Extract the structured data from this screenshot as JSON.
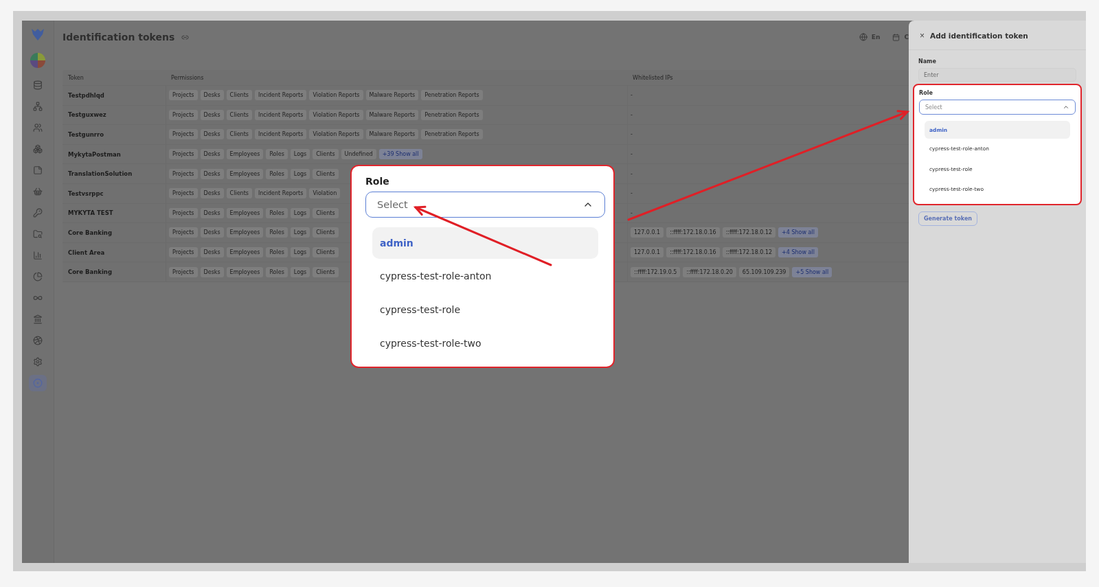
{
  "header": {
    "title": "Identification tokens",
    "language": "En",
    "cut_label": "C"
  },
  "sidebar": {
    "items": [
      {
        "selected": false
      },
      {
        "selected": false
      },
      {
        "selected": false
      },
      {
        "selected": false
      },
      {
        "selected": false
      },
      {
        "selected": false
      },
      {
        "selected": false
      },
      {
        "selected": false
      },
      {
        "selected": false
      },
      {
        "selected": false
      },
      {
        "selected": false
      },
      {
        "selected": false
      },
      {
        "selected": false
      },
      {
        "selected": false
      },
      {
        "selected": true
      }
    ]
  },
  "table": {
    "columns": [
      "Token",
      "Permissions",
      "Whitelisted IPs"
    ],
    "rows": [
      {
        "token": "Testpdhlqd",
        "permissions": [
          "Projects",
          "Desks",
          "Clients",
          "Incident Reports",
          "Violation Reports",
          "Malware Reports",
          "Penetration Reports"
        ],
        "ips": [
          "-"
        ]
      },
      {
        "token": "Testguxwez",
        "permissions": [
          "Projects",
          "Desks",
          "Clients",
          "Incident Reports",
          "Violation Reports",
          "Malware Reports",
          "Penetration Reports"
        ],
        "ips": [
          "-"
        ]
      },
      {
        "token": "Testgunrro",
        "permissions": [
          "Projects",
          "Desks",
          "Clients",
          "Incident Reports",
          "Violation Reports",
          "Malware Reports",
          "Penetration Reports"
        ],
        "ips": [
          "-"
        ]
      },
      {
        "token": "MykytaPostman",
        "permissions": [
          "Projects",
          "Desks",
          "Employees",
          "Roles",
          "Logs",
          "Clients",
          "Undefined"
        ],
        "permissions_more": "+39 Show all",
        "ips": [
          "-"
        ]
      },
      {
        "token": "TranslationSolution",
        "permissions": [
          "Projects",
          "Desks",
          "Employees",
          "Roles",
          "Logs",
          "Clients"
        ],
        "ips": [
          "-"
        ]
      },
      {
        "token": "Testvsrppc",
        "permissions": [
          "Projects",
          "Desks",
          "Clients",
          "Incident Reports",
          "Violation"
        ],
        "ips": [
          "-"
        ]
      },
      {
        "token": "MYKYTA TEST",
        "permissions": [
          "Projects",
          "Desks",
          "Employees",
          "Roles",
          "Logs",
          "Clients"
        ],
        "ips": [
          "-"
        ]
      },
      {
        "token": "Core Banking",
        "permissions": [
          "Projects",
          "Desks",
          "Employees",
          "Roles",
          "Logs",
          "Clients"
        ],
        "ips": [
          "127.0.0.1",
          "::ffff:172.18.0.16",
          "::ffff:172.18.0.12"
        ],
        "ips_more": "+4 Show all"
      },
      {
        "token": "Client Area",
        "permissions": [
          "Projects",
          "Desks",
          "Employees",
          "Roles",
          "Logs",
          "Clients"
        ],
        "ips": [
          "127.0.0.1",
          "::ffff:172.18.0.16",
          "::ffff:172.18.0.12"
        ],
        "ips_more": "+4 Show all"
      },
      {
        "token": "Core Banking",
        "permissions": [
          "Projects",
          "Desks",
          "Employees",
          "Roles",
          "Logs",
          "Clients"
        ],
        "ips": [
          "::ffff:172.19.0.5",
          "::ffff:172.18.0.20",
          "65.109.109.239"
        ],
        "ips_more": "+5 Show all"
      }
    ]
  },
  "drawer": {
    "close": "×",
    "title": "Add identification token",
    "name_field": {
      "label": "Name",
      "placeholder": "Enter"
    },
    "role_field": {
      "label": "Role",
      "placeholder": "Select",
      "expanded": true,
      "options": [
        {
          "label": "admin",
          "selected": true
        },
        {
          "label": "cypress-test-role-anton",
          "selected": false
        },
        {
          "label": "cypress-test-role",
          "selected": false
        },
        {
          "label": "cypress-test-role-two",
          "selected": false
        }
      ]
    },
    "button": "Generate token"
  },
  "callout": {
    "label": "Role",
    "placeholder": "Select",
    "expanded": true,
    "options": [
      {
        "label": "admin",
        "selected": true
      },
      {
        "label": "cypress-test-role-anton",
        "selected": false
      },
      {
        "label": "cypress-test-role",
        "selected": false
      },
      {
        "label": "cypress-test-role-two",
        "selected": false
      }
    ]
  }
}
